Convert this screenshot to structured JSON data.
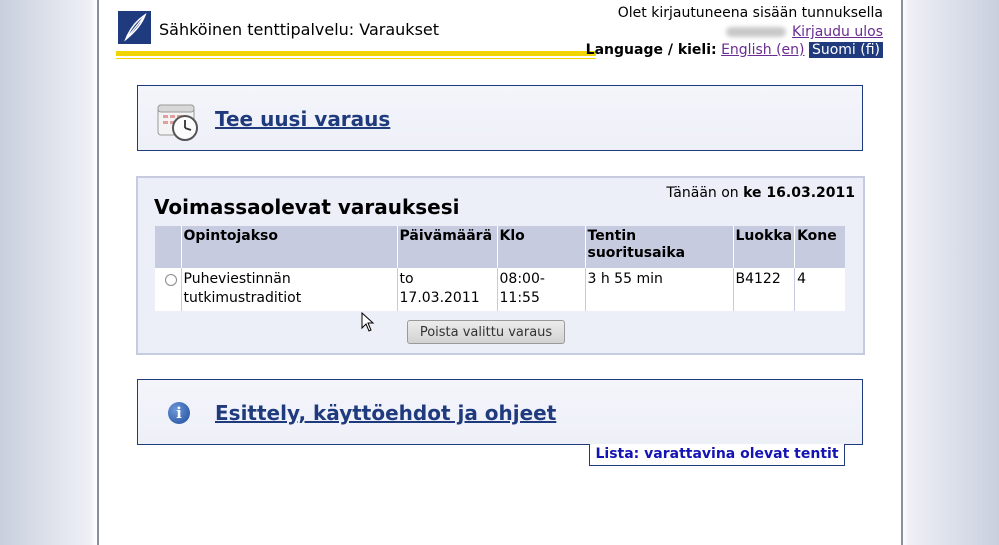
{
  "header": {
    "site_title": "Sähköinen tenttipalvelu: Varaukset",
    "logged_in_text": "Olet kirjautuneena sisään tunnuksella",
    "logout_label": "Kirjaudu ulos",
    "language_label": "Language / kieli:",
    "lang_en": "English (en)",
    "lang_fi": "Suomi (fi)"
  },
  "new_reservation": {
    "label": "Tee uusi varaus",
    "icon": "calendar-clock-icon"
  },
  "reservations": {
    "today_prefix": "Tänään on",
    "today_date": "ke 16.03.2011",
    "title": "Voimassaolevat varauksesi",
    "columns": [
      "Opintojakso",
      "Päivämäärä",
      "Klo",
      "Tentin suoritusaika",
      "Luokka",
      "Kone"
    ],
    "rows": [
      {
        "course": "Puheviestinnän tutkimustraditiot",
        "date": "to 17.03.2011",
        "time": "08:00-11:55",
        "duration": "3 h 55 min",
        "room": "B4122",
        "machine": "4"
      }
    ],
    "delete_button": "Poista valittu varaus"
  },
  "info": {
    "label": "Esittely, käyttöehdot ja ohjeet",
    "icon": "info-icon"
  },
  "list_tab": {
    "label": "Lista: varattavina olevat tentit"
  },
  "colors": {
    "brand_blue": "#1f3a7d",
    "accent_yellow": "#f2d500",
    "link_purple": "#6a2c91",
    "table_header": "#c7cbe0"
  }
}
